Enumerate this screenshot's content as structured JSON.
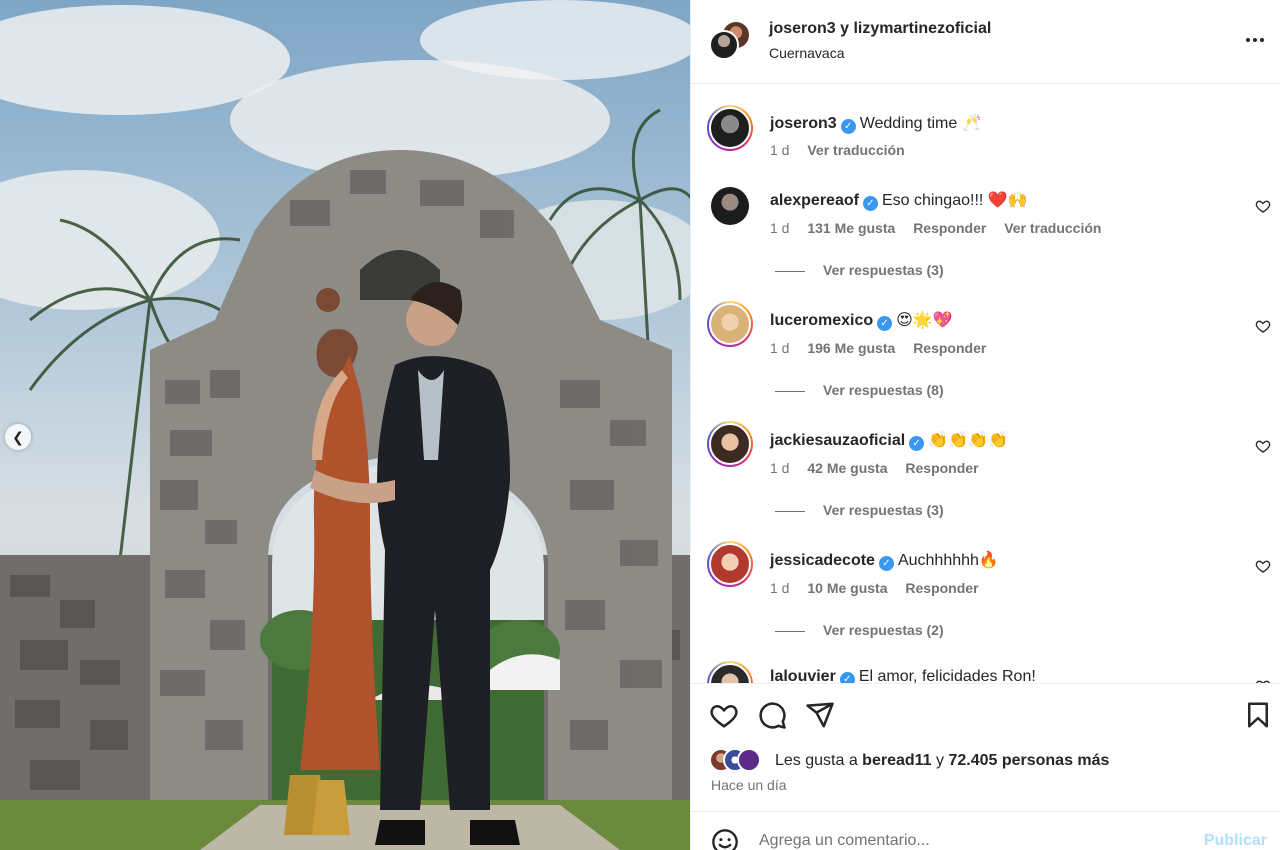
{
  "header": {
    "user1": "joseron3",
    "connector": " y ",
    "user2": "lizymartinezoficial",
    "location": "Cuernavaca"
  },
  "caption": {
    "username": "joseron3",
    "text": "Wedding time 🥂",
    "time": "1 d",
    "translate": "Ver traducción"
  },
  "comments": [
    {
      "username": "alexpereaof",
      "text": "Eso chingao!!! ❤️🙌",
      "time": "1 d",
      "likes": "131 Me gusta",
      "reply": "Responder",
      "translate": "Ver traducción",
      "replies": "Ver respuestas (3)"
    },
    {
      "username": "luceromexico",
      "text": "😍🌟💖",
      "time": "1 d",
      "likes": "196 Me gusta",
      "reply": "Responder",
      "replies": "Ver respuestas (8)"
    },
    {
      "username": "jackiesauzaoficial",
      "text": "👏👏👏👏",
      "time": "1 d",
      "likes": "42 Me gusta",
      "reply": "Responder",
      "replies": "Ver respuestas (3)"
    },
    {
      "username": "jessicadecote",
      "text": "Auchhhhhh🔥",
      "time": "1 d",
      "likes": "10 Me gusta",
      "reply": "Responder",
      "replies": "Ver respuestas (2)"
    },
    {
      "username": "lalouvier",
      "text": "El amor, felicidades Ron!"
    }
  ],
  "likes": {
    "prefix": "Les gusta a ",
    "user": "beread11",
    "middle": " y ",
    "count": "72.405 personas más"
  },
  "posted": "Hace un día",
  "add_comment": {
    "placeholder": "Agrega un comentario...",
    "publish": "Publicar"
  },
  "icons": {
    "like": "heart-icon",
    "comment": "comment-icon",
    "share": "share-icon",
    "save": "bookmark-icon",
    "more": "more-icon",
    "emoji": "emoji-icon",
    "prev": "chevron-left-icon"
  },
  "colors": {
    "verified": "#3897f0",
    "text": "#262626",
    "secondary": "#737373",
    "publish_disabled": "#b2dffc"
  }
}
